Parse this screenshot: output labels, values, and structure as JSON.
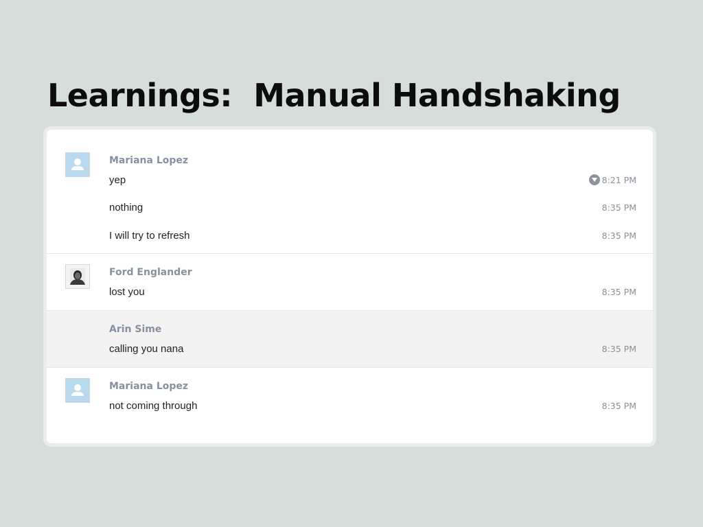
{
  "slide": {
    "title": "Learnings:  Manual Handshaking"
  },
  "chat": {
    "groups": [
      {
        "sender": "Mariana Lopez",
        "avatar": "default-avatar-icon",
        "messages": [
          {
            "text": "yep",
            "time": "8:21 PM",
            "menu_icon": "caret-down-circle-icon"
          },
          {
            "text": "nothing",
            "time": "8:35 PM"
          },
          {
            "text": "I will try to refresh",
            "time": "8:35 PM"
          }
        ]
      },
      {
        "sender": "Ford Englander",
        "avatar": "photo-avatar",
        "messages": [
          {
            "text": "lost you",
            "time": "8:35 PM"
          }
        ]
      },
      {
        "sender": "Arin Sime",
        "avatar": "",
        "highlighted": true,
        "messages": [
          {
            "text": "calling you nana",
            "time": "8:35 PM"
          }
        ]
      },
      {
        "sender": "Mariana Lopez",
        "avatar": "default-avatar-icon",
        "messages": [
          {
            "text": "not coming through",
            "time": "8:35 PM"
          }
        ]
      }
    ]
  },
  "colors": {
    "background": "#d6dedb",
    "card": "#ffffff",
    "sender_name": "#8790a0",
    "timestamp": "#8a8f98",
    "highlight_row": "#f3f3f3",
    "default_avatar": "#b8d9ee"
  }
}
